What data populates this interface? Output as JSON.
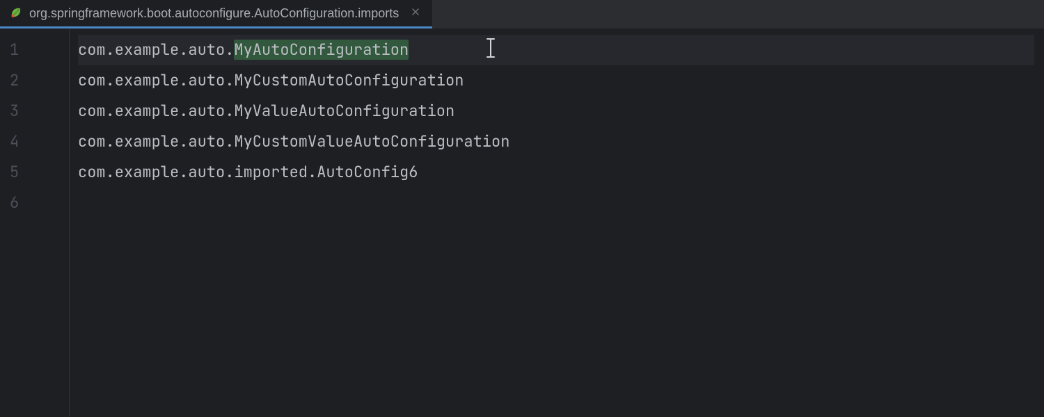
{
  "tab": {
    "label": "org.springframework.boot.autoconfigure.AutoConfiguration.imports",
    "icon": "spring-leaf-icon"
  },
  "editor": {
    "lines": [
      {
        "number": "1",
        "prefix": "com.example.auto.",
        "highlighted": "MyAutoConfiguration",
        "suffix": "",
        "active": true
      },
      {
        "number": "2",
        "prefix": "com.example.auto.MyCustomAutoConfiguration",
        "highlighted": "",
        "suffix": "",
        "active": false
      },
      {
        "number": "3",
        "prefix": "com.example.auto.MyValueAutoConfiguration",
        "highlighted": "",
        "suffix": "",
        "active": false
      },
      {
        "number": "4",
        "prefix": "com.example.auto.MyCustomValueAutoConfiguration",
        "highlighted": "",
        "suffix": "",
        "active": false
      },
      {
        "number": "5",
        "prefix": "com.example.auto.imported.AutoConfig6",
        "highlighted": "",
        "suffix": "",
        "active": false
      },
      {
        "number": "6",
        "prefix": "",
        "highlighted": "",
        "suffix": "",
        "active": false
      }
    ]
  }
}
